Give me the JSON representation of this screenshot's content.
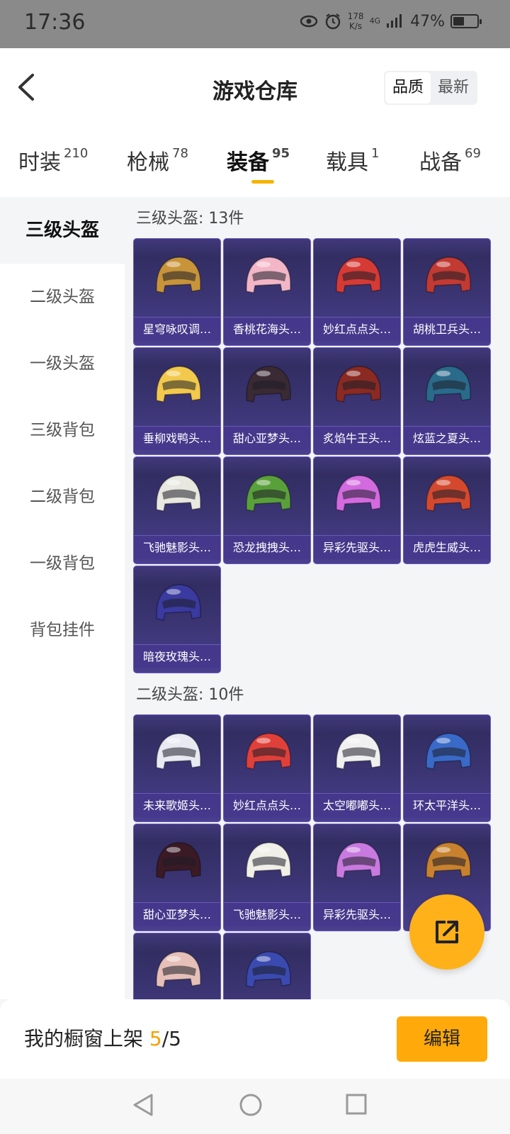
{
  "status": {
    "time": "17:36",
    "speed_top": "178",
    "speed_bottom": "K/s",
    "network": "4G",
    "battery": "47%",
    "battery_level": 0.47
  },
  "header": {
    "title": "游戏仓库",
    "sort_options": [
      "品质",
      "最新"
    ],
    "active_sort": "品质"
  },
  "tabs": [
    {
      "label": "时装",
      "count": "210"
    },
    {
      "label": "枪械",
      "count": "78"
    },
    {
      "label": "装备",
      "count": "95"
    },
    {
      "label": "载具",
      "count": "1"
    },
    {
      "label": "战备",
      "count": "69"
    }
  ],
  "active_tab": "装备",
  "sidebar": [
    {
      "label": "三级头盔"
    },
    {
      "label": "二级头盔"
    },
    {
      "label": "一级头盔"
    },
    {
      "label": "三级背包"
    },
    {
      "label": "二级背包"
    },
    {
      "label": "一级背包"
    },
    {
      "label": "背包挂件"
    }
  ],
  "sections": [
    {
      "title": "三级头盔: 13件",
      "items": [
        {
          "name": "星穹咏叹调…",
          "color": "#c8943a"
        },
        {
          "name": "香桃花海头…",
          "color": "#f2b6c6"
        },
        {
          "name": "妙红点点头…",
          "color": "#d63a35"
        },
        {
          "name": "胡桃卫兵头…",
          "color": "#c23a32"
        },
        {
          "name": "垂柳戏鸭头…",
          "color": "#f2c94c"
        },
        {
          "name": "甜心亚梦头…",
          "color": "#3a2a34"
        },
        {
          "name": "炙焰牛王头…",
          "color": "#8a2a22"
        },
        {
          "name": "炫蓝之夏头…",
          "color": "#2a6a8a"
        },
        {
          "name": "飞驰魅影头…",
          "color": "#e8e8e0"
        },
        {
          "name": "恐龙拽拽头…",
          "color": "#5aa03a"
        },
        {
          "name": "异彩先驱头…",
          "color": "#d36adf"
        },
        {
          "name": "虎虎生威头…",
          "color": "#d4492e"
        },
        {
          "name": "暗夜玫瑰头…",
          "color": "#3a3aa0"
        }
      ]
    },
    {
      "title": "二级头盔: 10件",
      "items": [
        {
          "name": "未来歌姬头…",
          "color": "#e8eaf2"
        },
        {
          "name": "妙红点点头…",
          "color": "#e0403a"
        },
        {
          "name": "太空嘟嘟头…",
          "color": "#f0f0f0"
        },
        {
          "name": "环太平洋头…",
          "color": "#3a6ac8"
        },
        {
          "name": "甜心亚梦头…",
          "color": "#3a1a24"
        },
        {
          "name": "飞驰魅影头…",
          "color": "#f0f0e8"
        },
        {
          "name": "异彩先驱头…",
          "color": "#c87ae0"
        },
        {
          "name": "",
          "color": "#c8822e"
        },
        {
          "name": "",
          "color": "#e6c0b8"
        },
        {
          "name": "",
          "color": "#3a4ab0"
        }
      ]
    }
  ],
  "bottom": {
    "text": "我的橱窗上架",
    "current": "5",
    "total": "/5",
    "edit_label": "编辑"
  }
}
